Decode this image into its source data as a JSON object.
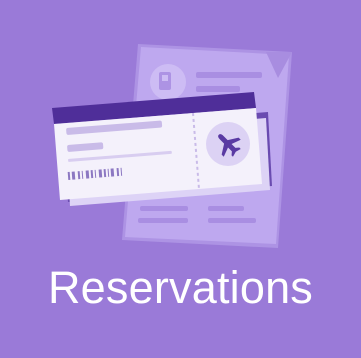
{
  "tile": {
    "label": "Reservations",
    "icon": "boarding-pass-icon"
  },
  "colors": {
    "background": "#9a7ad8",
    "paper": "#b8a2ea",
    "ticket_header": "#4f2e99",
    "ticket_body": "#f4f1fb",
    "accent": "#5a3aa3",
    "text": "#ffffff"
  }
}
